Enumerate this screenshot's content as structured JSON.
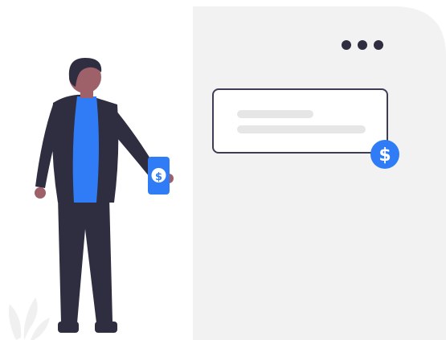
{
  "illustration": {
    "phone_symbol": "$",
    "card_badge_symbol": "$",
    "menu_dot_count": 3
  },
  "colors": {
    "panel": "#f2f2f2",
    "panel_edge": "#e6e6e6",
    "accent_blue": "#2f7cf6",
    "dark": "#2f2e41",
    "skin": "#9e616a",
    "hair": "#2f2e41",
    "skeleton_line": "#e6e6e6",
    "leaf": "#f0f0f0"
  },
  "icons": [
    "more-dots-icon",
    "dollar-icon",
    "leaf-icon"
  ]
}
